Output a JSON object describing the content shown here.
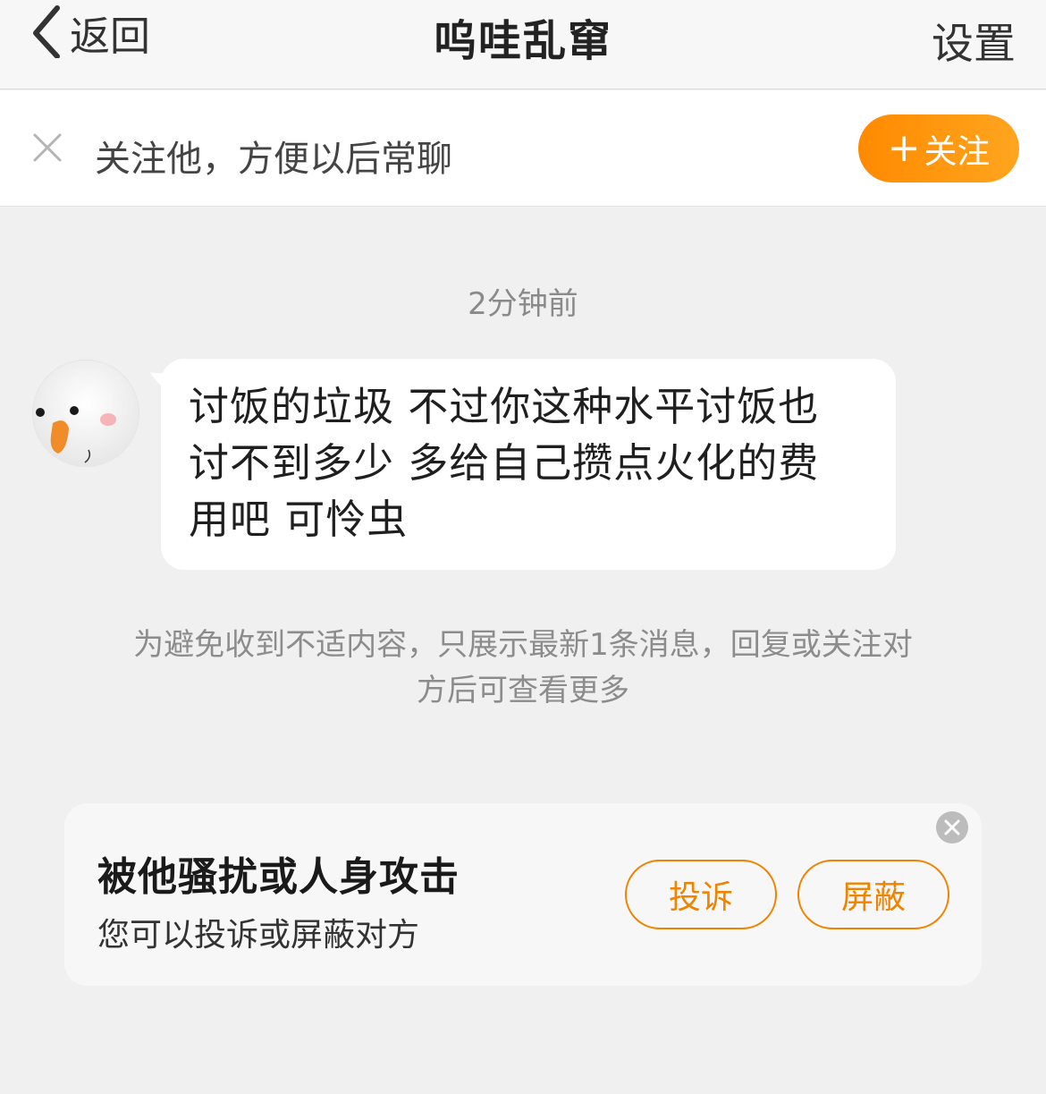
{
  "nav": {
    "back_label": "返回",
    "title": "呜哇乱窜",
    "settings_label": "设置"
  },
  "follow_bar": {
    "prompt": "关注他，方便以后常聊",
    "button_plus": "+",
    "button_label": "关注",
    "accent_color": "#ff8a00"
  },
  "chat": {
    "timestamp": "2分钟前",
    "messages": [
      {
        "lines": [
          "讨饭的垃圾 不过你这种水平讨饭也",
          "讨不到多少 多给自己攒点火化的费",
          "用吧 可怜虫"
        ]
      }
    ],
    "notice_lines": [
      "为避免收到不适内容，只展示最新1条消息，回复或关注对",
      "方后可查看更多"
    ]
  },
  "safety_card": {
    "title": "被他骚扰或人身攻击",
    "subtitle": "您可以投诉或屏蔽对方",
    "report_label": "投诉",
    "block_label": "屏蔽",
    "accent_color": "#f08300"
  }
}
